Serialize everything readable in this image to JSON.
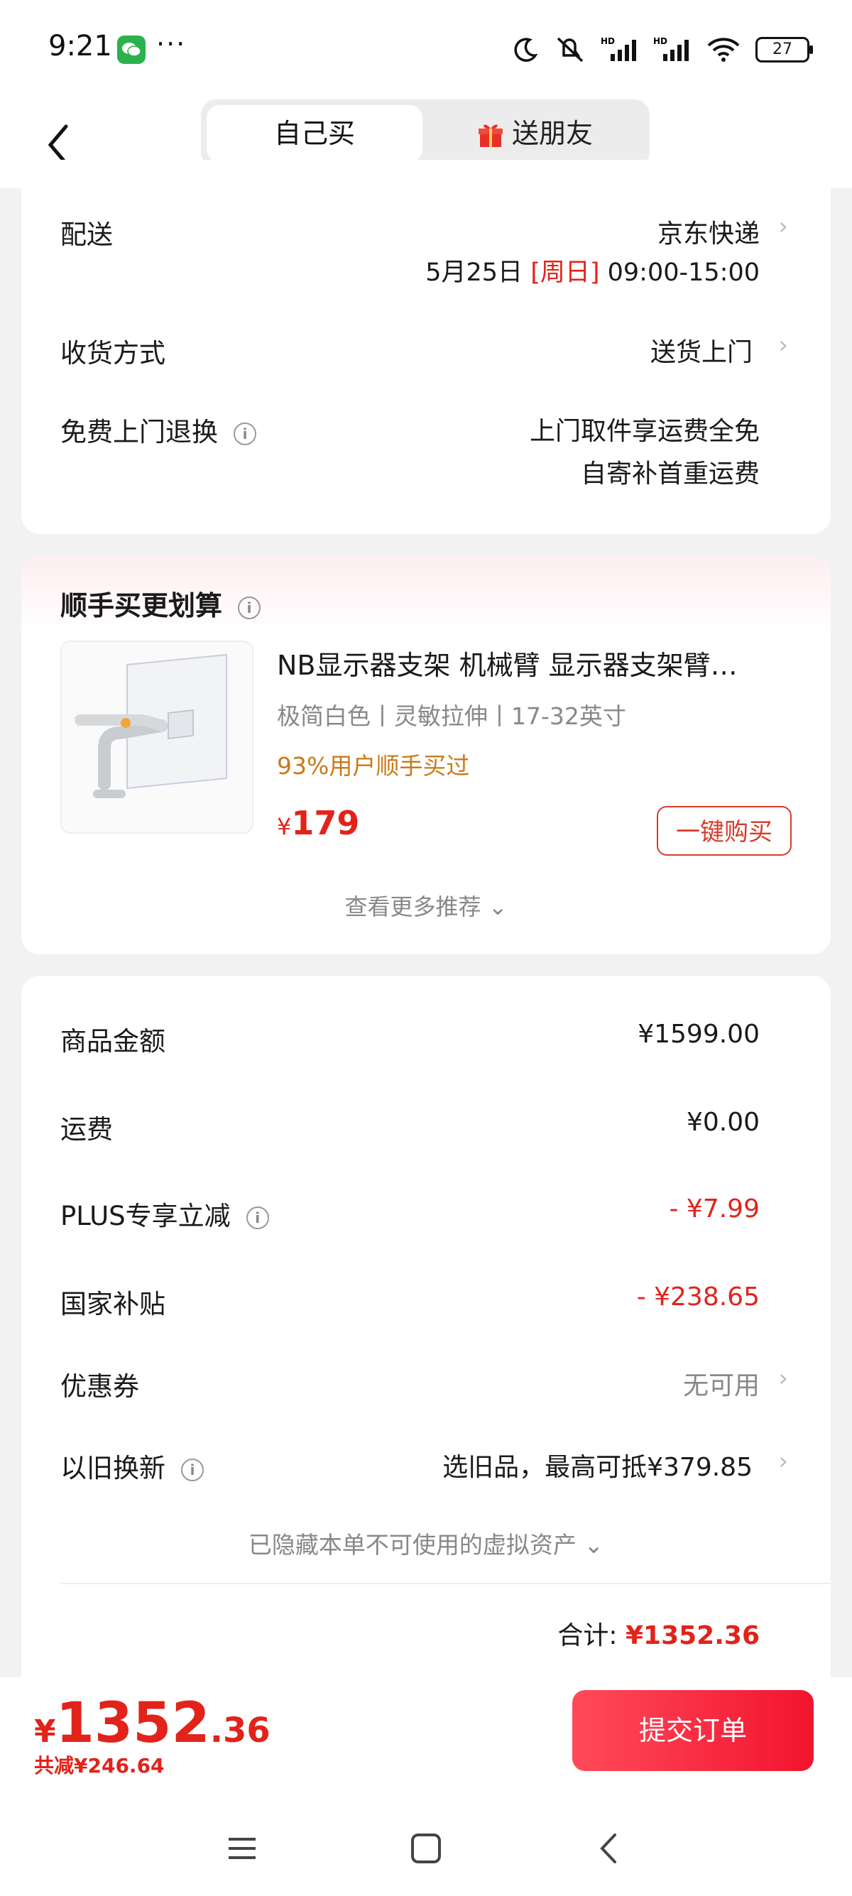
{
  "status_bar": {
    "time": "9:21",
    "dots": "···",
    "battery": "27"
  },
  "header": {
    "tab_self": "自己买",
    "tab_friend": "送朋友"
  },
  "delivery": {
    "label": "配送",
    "carrier": "京东快递",
    "date": "5月25日",
    "weekday": "[周日]",
    "window": "09:00-15:00",
    "receive_label": "收货方式",
    "receive_value": "送货上门",
    "return_label": "免费上门退换",
    "return_line1": "上门取件享运费全免",
    "return_line2": "自寄补首重运费"
  },
  "recommend": {
    "title": "顺手买更划算",
    "product_title": "NB显示器支架 机械臂 显示器支架臂…",
    "spec": "极简白色丨灵敏拉伸丨17-32英寸",
    "buyers": "93%用户顺手买过",
    "currency": "¥",
    "price": "179",
    "buy_button": "一键购买",
    "more": "查看更多推荐"
  },
  "summary": {
    "goods_label": "商品金额",
    "goods_value": "¥1599.00",
    "shipping_label": "运费",
    "shipping_value": "¥0.00",
    "plus_label": "PLUS专享立减",
    "plus_value": "- ¥7.99",
    "subsidy_label": "国家补贴",
    "subsidy_value": "- ¥238.65",
    "coupon_label": "优惠券",
    "coupon_value": "无可用",
    "tradein_label": "以旧换新",
    "tradein_value": "选旧品，最高可抵¥379.85",
    "hidden_assets": "已隐藏本单不可使用的虚拟资产",
    "total_label": "合计:",
    "total_value": "¥1352.36"
  },
  "bottom": {
    "currency": "¥",
    "price_int": "1352",
    "price_dec": ".36",
    "saved": "共减¥246.64",
    "submit": "提交订单"
  },
  "colors": {
    "accent": "#e2231a",
    "submit_start": "#ff4a5b",
    "submit_end": "#f2142d"
  }
}
